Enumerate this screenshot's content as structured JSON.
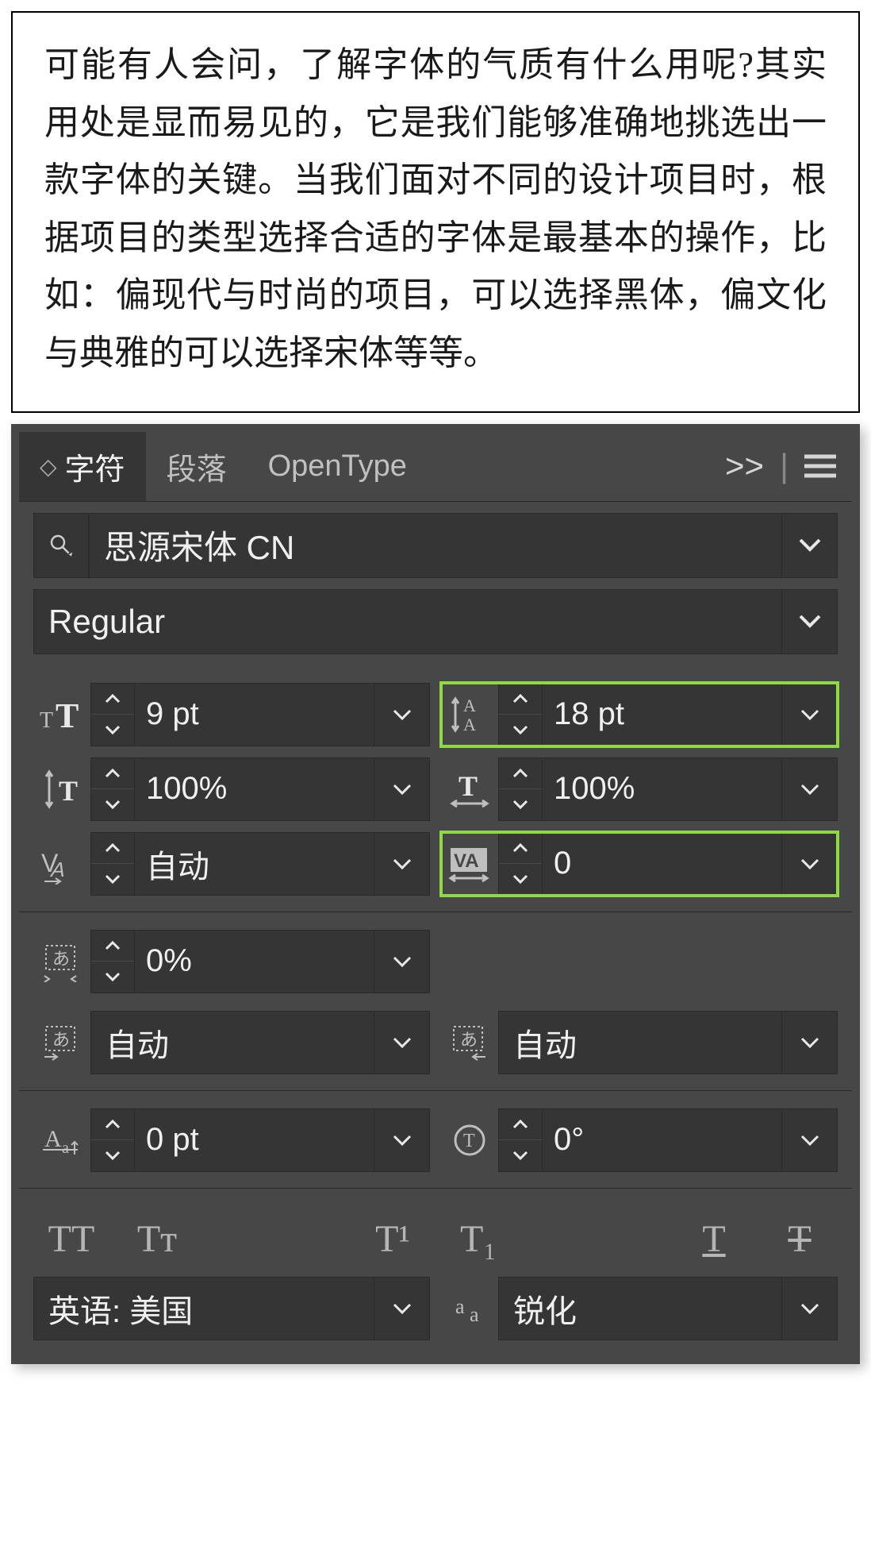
{
  "textBlock": "可能有人会问，了解字体的气质有什么用呢?其实用处是显而易见的，它是我们能够准确地挑选出一款字体的关键。当我们面对不同的设计项目时，根据项目的类型选择合适的字体是最基本的操作，比如：偏现代与时尚的项目，可以选择黑体，偏文化与典雅的可以选择宋体等等。",
  "tabs": {
    "character": "字符",
    "paragraph": "段落",
    "opentype": "OpenType",
    "more": ">>"
  },
  "font": {
    "family": "思源宋体 CN",
    "weight": "Regular"
  },
  "fields": {
    "fontSize": "9 pt",
    "leading": "18 pt",
    "vertScale": "100%",
    "horizScale": "100%",
    "kerning": "自动",
    "tracking": "0",
    "tsume": "0%",
    "akiLeft": "自动",
    "akiRight": "自动",
    "baselineShift": "0 pt",
    "rotation": "0°"
  },
  "buttons": {
    "allCaps": "TT",
    "smallCaps": "Tᴛ",
    "superscript": "T¹",
    "subscript": "T₁",
    "underline": "T",
    "strike": "T"
  },
  "bottom": {
    "language": "英语: 美国",
    "antialias": "锐化"
  }
}
